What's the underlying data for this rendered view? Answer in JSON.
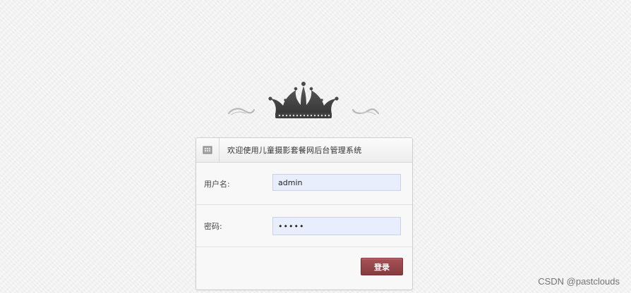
{
  "header": {
    "title": "欢迎使用儿童摄影套餐网后台管理系统"
  },
  "form": {
    "username_label": "用户名:",
    "username_value": "admin",
    "password_label": "密码:",
    "password_value": "•••••",
    "login_button_label": "登录"
  },
  "watermark": "CSDN @pastclouds",
  "colors": {
    "background": "#f2f2f2",
    "input_fill": "#e8eefb",
    "button": "#8f4245",
    "crown": "#4a4a4a"
  }
}
